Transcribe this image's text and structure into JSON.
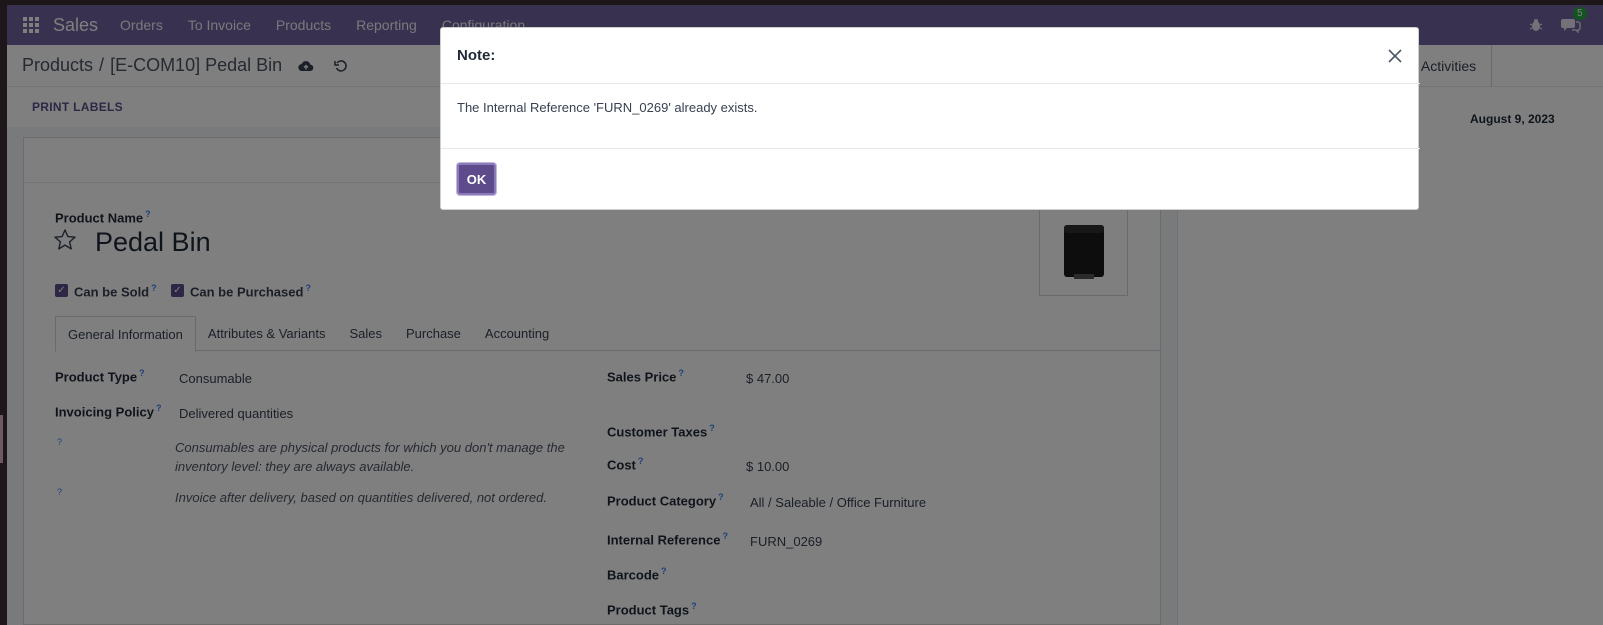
{
  "navbar": {
    "brand": "Sales",
    "menu": [
      "Orders",
      "To Invoice",
      "Products",
      "Reporting",
      "Configuration"
    ],
    "chat_badge": "5",
    "color": "#71639e"
  },
  "breadcrumb": {
    "parent": "Products",
    "separator": "/",
    "current": "[E-COM10] Pedal Bin"
  },
  "toolbar": {
    "print_labels": "PRINT LABELS",
    "activities": "Activities"
  },
  "chatter": {
    "date": "August 9, 2023"
  },
  "product": {
    "name_label": "Product Name",
    "name": "Pedal Bin",
    "can_be_sold": "Can be Sold",
    "can_be_purchased": "Can be Purchased",
    "help_mark": "?"
  },
  "tabs": [
    "General Information",
    "Attributes & Variants",
    "Sales",
    "Purchase",
    "Accounting"
  ],
  "left_fields": {
    "product_type_label": "Product Type",
    "product_type": "Consumable",
    "invoicing_policy_label": "Invoicing Policy",
    "invoicing_policy": "Delivered quantities",
    "help1_line1": "Consumables are physical products for which you don't manage the",
    "help1_line2": "inventory level: they are always available.",
    "help2": "Invoice after delivery, based on quantities delivered, not ordered."
  },
  "right_fields": {
    "sales_price_label": "Sales Price",
    "sales_price": "$ 47.00",
    "customer_taxes_label": "Customer Taxes",
    "cost_label": "Cost",
    "cost": "$ 10.00",
    "category_label": "Product Category",
    "category": "All / Saleable / Office Furniture",
    "internal_ref_label": "Internal Reference",
    "internal_ref": "FURN_0269",
    "barcode_label": "Barcode",
    "tags_label": "Product Tags"
  },
  "dialog": {
    "title": "Note:",
    "message": "The Internal Reference 'FURN_0269' already exists.",
    "ok_label": "OK"
  }
}
